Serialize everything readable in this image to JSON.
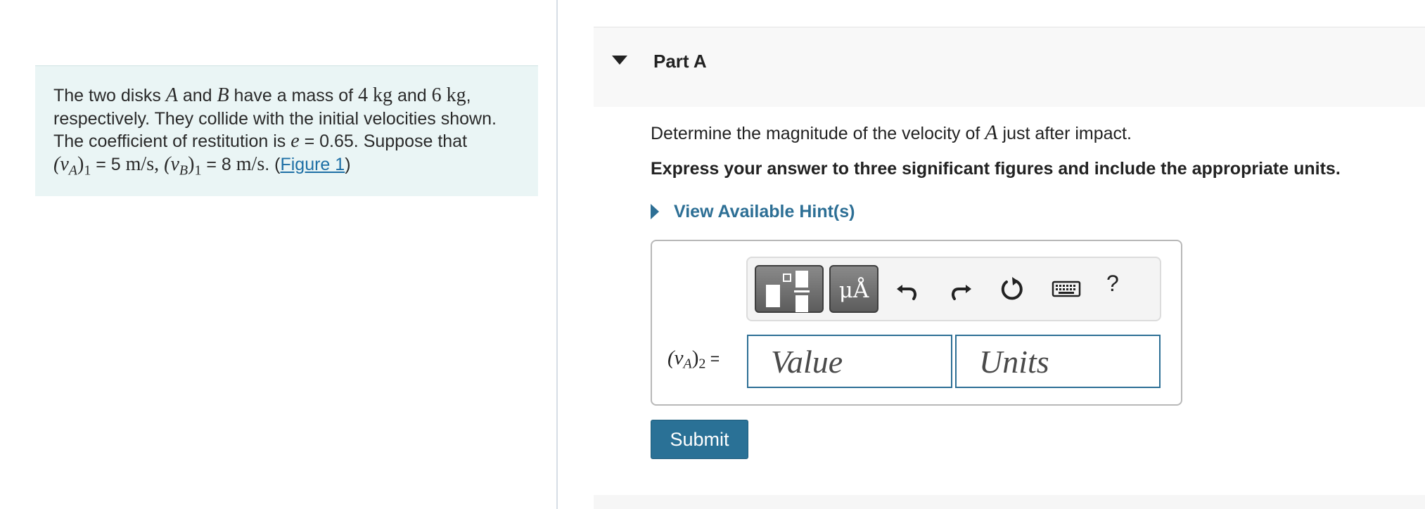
{
  "problem": {
    "line1_pre": "The two disks ",
    "disk_a": "A",
    "line1_and": " and ",
    "disk_b": "B",
    "line1_mass_pre": " have a mass of ",
    "mass_a": "4 kg",
    "line1_mass_and": " and ",
    "mass_b": "6 kg",
    "line1_end": ",",
    "line2": "respectively. They collide with the initial velocities shown.",
    "line3_pre": "The coefficient of restitution is ",
    "e_symbol": "e",
    "e_value": " = 0.65. Suppose that",
    "va_label": "(v",
    "va_sub": "A",
    "va_close": ")",
    "va_idx": "1",
    "va_eq": " = 5 ",
    "va_unit": "m/s",
    "sep": ", ",
    "vb_label": "(v",
    "vb_sub": "B",
    "vb_close": ")",
    "vb_idx": "1",
    "vb_eq": " = 8 ",
    "vb_unit": "m/s",
    "end": ". (",
    "figure_link": "Figure 1",
    "end_paren": ")"
  },
  "part": {
    "title": "Part A",
    "question_pre": "Determine the magnitude of the velocity of ",
    "question_var": "A",
    "question_post": " just after impact.",
    "instruction": "Express your answer to three significant figures and include the appropriate units.",
    "hint_label": "View Available Hint(s)"
  },
  "toolbar": {
    "units_button": "μÅ",
    "help_label": "?",
    "icons": [
      "fraction-template-icon",
      "units-icon",
      "undo-icon",
      "redo-icon",
      "reset-icon",
      "keyboard-icon",
      "help-icon"
    ]
  },
  "answer": {
    "label_open": "(v",
    "label_sub": "A",
    "label_close": ")",
    "label_idx": "2",
    "label_eq": " =",
    "value_placeholder": "Value",
    "units_placeholder": "Units"
  },
  "submit_label": "Submit",
  "colors": {
    "accent": "#2a7196",
    "problem_bg": "#eaf5f5",
    "link": "#1d6fa5"
  }
}
